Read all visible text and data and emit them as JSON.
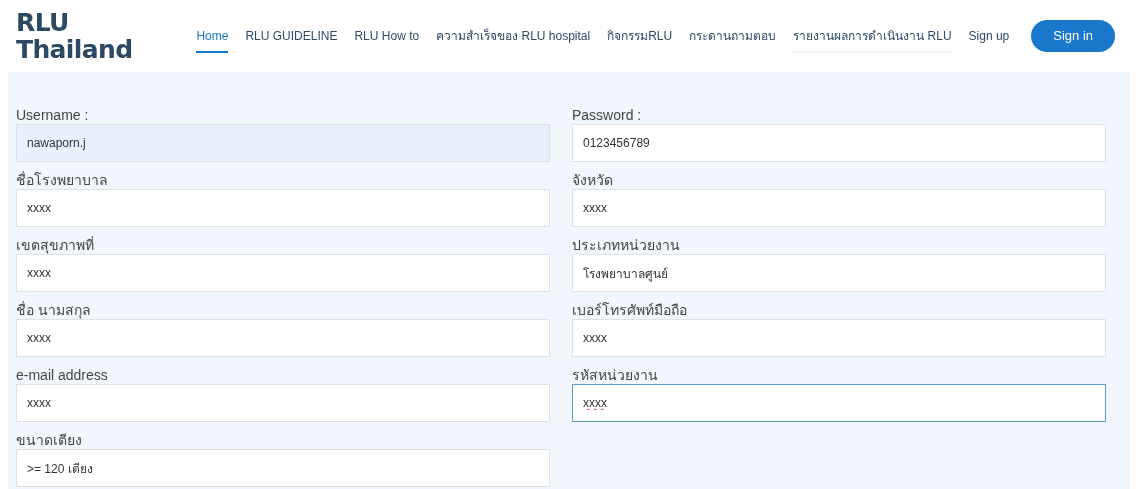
{
  "logo": {
    "lines": [
      "RLU",
      "Thailand"
    ]
  },
  "nav": [
    {
      "label": "Home",
      "selected": true,
      "hovered": false
    },
    {
      "label": "RLU GUIDELINE",
      "selected": false,
      "hovered": false
    },
    {
      "label": "RLU How to",
      "selected": false,
      "hovered": false
    },
    {
      "label": "ความสำเร็จของ RLU hospital",
      "selected": false,
      "hovered": false
    },
    {
      "label": "กิจกรรมRLU",
      "selected": false,
      "hovered": false
    },
    {
      "label": "กระดานถามตอบ",
      "selected": false,
      "hovered": false
    },
    {
      "label": "รายงานผลการดำเนินงาน RLU",
      "selected": false,
      "hovered": true
    },
    {
      "label": "Sign up",
      "selected": false,
      "hovered": false
    }
  ],
  "sign_in_button": "Sign in",
  "fields": [
    {
      "label": "Username :",
      "value": "nawaporn.j",
      "autofilled": true,
      "focused": false,
      "spell_error": false
    },
    {
      "label": "Password :",
      "value": "0123456789",
      "autofilled": false,
      "focused": false,
      "spell_error": false
    },
    {
      "label": "ชื่อโรงพยาบาล",
      "value": "xxxx",
      "autofilled": false,
      "focused": false,
      "spell_error": false
    },
    {
      "label": "จังหวัด",
      "value": "xxxx",
      "autofilled": false,
      "focused": false,
      "spell_error": false
    },
    {
      "label": "เขตสุขภาพที่",
      "value": "xxxx",
      "autofilled": false,
      "focused": false,
      "spell_error": false
    },
    {
      "label": "ประเภทหน่วยงาน",
      "value": "โรงพยาบาลศูนย์",
      "autofilled": false,
      "focused": false,
      "spell_error": false
    },
    {
      "label": "ชื่อ นามสกุล",
      "value": "xxxx",
      "autofilled": false,
      "focused": false,
      "spell_error": false
    },
    {
      "label": "เบอร์โทรศัพท์มือถือ",
      "value": "xxxx",
      "autofilled": false,
      "focused": false,
      "spell_error": false
    },
    {
      "label": "e-mail address",
      "value": "xxxx",
      "autofilled": false,
      "focused": false,
      "spell_error": false
    },
    {
      "label": "รหัสหน่วยงาน",
      "value": "xxxx",
      "autofilled": false,
      "focused": true,
      "spell_error": true
    },
    {
      "label": "ขนาดเตียง",
      "value": ">= 120 เตียง",
      "autofilled": false,
      "focused": false,
      "spell_error": false
    }
  ]
}
